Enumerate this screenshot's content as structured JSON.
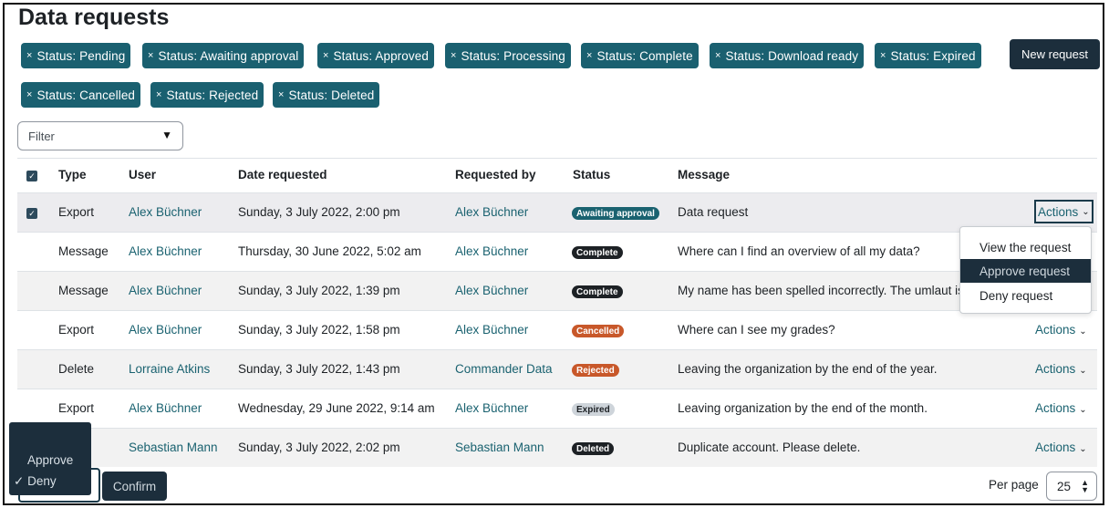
{
  "page": {
    "title": "Data requests"
  },
  "filters": {
    "chips": [
      "Status: Pending",
      "Status: Awaiting approval",
      "Status: Approved",
      "Status: Processing",
      "Status: Complete",
      "Status: Download ready",
      "Status: Expired",
      "Status: Cancelled",
      "Status: Rejected",
      "Status: Deleted"
    ],
    "remove_symbol": "×",
    "select_placeholder": "Filter"
  },
  "toolbar": {
    "new_request_label": "New request"
  },
  "table": {
    "headers": {
      "type": "Type",
      "user": "User",
      "date": "Date requested",
      "requested_by": "Requested by",
      "status": "Status",
      "message": "Message"
    },
    "rows": [
      {
        "type": "Export",
        "user": "Alex Büchner",
        "date": "Sunday, 3 July 2022, 2:00 pm",
        "requested_by": "Alex Büchner",
        "status": "Awaiting approval",
        "message": "Data request",
        "actions": "Actions",
        "checked": true
      },
      {
        "type": "Message",
        "user": "Alex Büchner",
        "date": "Thursday, 30 June 2022, 5:02 am",
        "requested_by": "Alex Büchner",
        "status": "Complete",
        "message": "Where can I find an overview of all my data?",
        "actions": "",
        "checked": false
      },
      {
        "type": "Message",
        "user": "Alex Büchner",
        "date": "Sunday, 3 July 2022, 1:39 pm",
        "requested_by": "Alex Büchner",
        "status": "Complete",
        "message": "My name has been spelled incorrectly. The umlaut is",
        "actions": "",
        "checked": false
      },
      {
        "type": "Export",
        "user": "Alex Büchner",
        "date": "Sunday, 3 July 2022, 1:58 pm",
        "requested_by": "Alex Büchner",
        "status": "Cancelled",
        "message": "Where can I see my grades?",
        "actions": "Actions",
        "checked": false
      },
      {
        "type": "Delete",
        "user": "Lorraine Atkins",
        "date": "Sunday, 3 July 2022, 1:43 pm",
        "requested_by": "Commander Data",
        "status": "Rejected",
        "message": "Leaving the organization by the end of the year.",
        "actions": "Actions",
        "checked": false
      },
      {
        "type": "Export",
        "user": "Alex Büchner",
        "date": "Wednesday, 29 June 2022, 9:14 am",
        "requested_by": "Alex Büchner",
        "status": "Expired",
        "message": "Leaving organization by the end of the month.",
        "actions": "Actions",
        "checked": false
      },
      {
        "type": "",
        "user": "Sebastian Mann",
        "date": "Sunday, 3 July 2022, 2:02 pm",
        "requested_by": "Sebastian Mann",
        "status": "Deleted",
        "message": "Duplicate account. Please delete.",
        "actions": "Actions",
        "checked": false
      }
    ]
  },
  "status_colors": {
    "Awaiting approval": "#1a6270",
    "Complete": "#1d2125",
    "Cancelled": "#c8582a",
    "Rejected": "#c8582a",
    "Expired": "#ced4da",
    "Deleted": "#1d2125"
  },
  "actions_menu": {
    "items": [
      "View the request",
      "Approve request",
      "Deny request"
    ],
    "highlighted": "Approve request"
  },
  "bulk": {
    "options": [
      "Approve",
      "Deny"
    ],
    "selected": "Deny",
    "check_symbol": "✓",
    "confirm_label": "Confirm"
  },
  "pagination": {
    "per_page_label": "Per page",
    "per_page_value": "25"
  }
}
